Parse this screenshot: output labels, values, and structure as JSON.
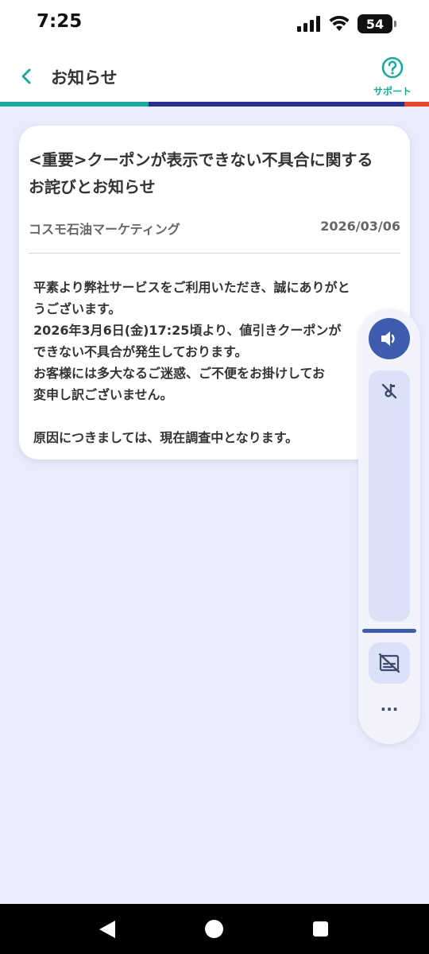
{
  "status_bar": {
    "time": "7:25",
    "battery": "54"
  },
  "header": {
    "title": "お知らせ",
    "support_label": "サポート"
  },
  "colors": {
    "accent_teal": "#1aa99a",
    "accent_navy": "#2a2e8c",
    "accent_red": "#e8452f",
    "panel_blue": "#3e5cad"
  },
  "notice": {
    "title_line1": "<重要>クーポンが表示できない不具合に関する",
    "title_line2": "お詫びとお知らせ",
    "publisher": "コスモ石油マーケティング",
    "date": "2026/03/06",
    "body_lines": [
      "平素より弊社サービスをご利用いただき、誠にありがと",
      "うございます。",
      "2026年3月6日(金)17:25頃より、値引きクーポンが",
      "できない不具合が発生しております。",
      "お客様には多大なるご迷惑、ご不便をお掛けしてお",
      "変申し訳ございません。",
      "原因につきましては、現在調査中となります。"
    ]
  },
  "volume_panel": {
    "more_label": "···"
  }
}
